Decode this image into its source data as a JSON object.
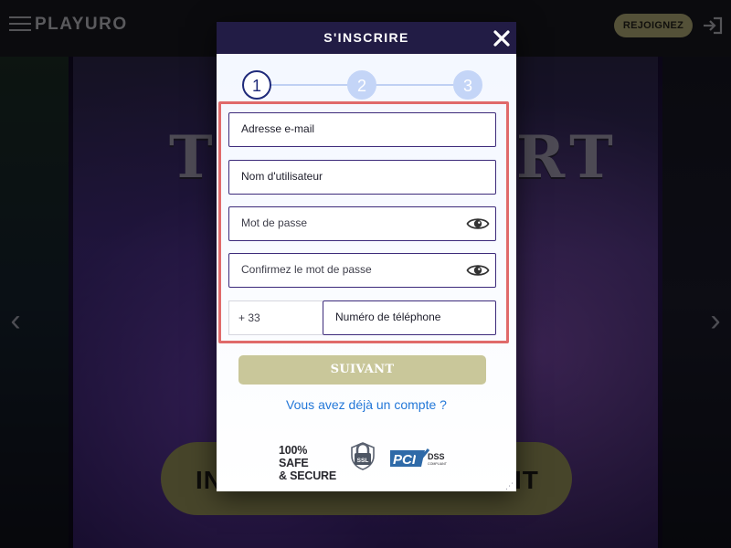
{
  "header": {
    "logo_text": "PLAYURO",
    "join_button": "REJOIGNEZ",
    "icons": {
      "menu": "hamburger-icon",
      "login": "sign-in-icon"
    }
  },
  "background": {
    "hero_title_left": "TI",
    "hero_title_right": "RT",
    "cta_left": "IN",
    "cta_right": "IT",
    "arrows": {
      "left": "‹",
      "right": "›"
    }
  },
  "modal": {
    "title": "S'INSCRIRE",
    "close_icon": "close-icon",
    "steps": [
      "1",
      "2",
      "3"
    ],
    "current_step": 1,
    "fields": {
      "email_placeholder": "Adresse e-mail",
      "username_placeholder": "Nom d'utilisateur",
      "password_placeholder": "Mot de passe",
      "confirm_password_placeholder": "Confirmez le mot de passe",
      "phone_prefix": "+ 33",
      "phone_placeholder": "Numéro de téléphone"
    },
    "next_button": "SUIVANT",
    "login_link": "Vous avez déjà un compte ?",
    "badges": {
      "safe_line1": "100% SAFE",
      "safe_line2": "& SECURE",
      "ssl": "SSL",
      "pci": "PCI",
      "dss": "DSS",
      "dss_sub": "COMPLIANT"
    },
    "colors": {
      "header_bg": "#221c45",
      "field_border": "#3c2a7a",
      "highlight_border": "#e06a6a",
      "link": "#2478d8",
      "button_bg": "#c9c79a"
    }
  }
}
